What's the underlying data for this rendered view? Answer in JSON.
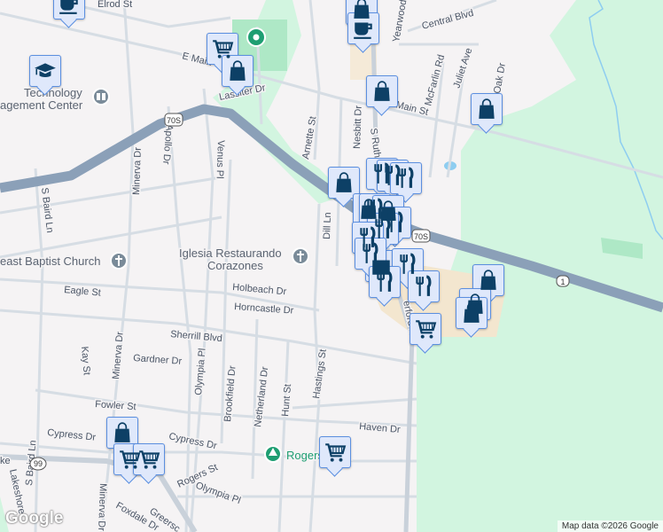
{
  "streets": {
    "elrod": "Elrod St",
    "e_main": "E Main St",
    "main": "Main St",
    "lassiter": "Lassiter Dr",
    "central": "Central Blvd",
    "yearwood": "Yearwood",
    "mcfarlin": "McFarlin Rd",
    "juliet": "Juliet Ave",
    "oak": "Oak Dr",
    "nesbitt": "Nesbitt Dr",
    "s_ruth": "S Ruth",
    "arnette": "Arnette St",
    "venus": "Venus Pl",
    "apollo": "Apollo Dr",
    "minerva": "Minerva Dr",
    "s_baird": "S Baird Ln",
    "dill": "Dill Ln",
    "holbeach": "Holbeach Dr",
    "horncastle": "Horncastle Dr",
    "eagle": "Eagle St",
    "sherrill": "Sherrill Blvd",
    "gardner": "Gardner Dr",
    "kay": "Kay St",
    "olympia": "Olympia Pl",
    "brookfield": "Brookfield Dr",
    "netherland": "Netherland Dr",
    "hunt": "Hunt St",
    "hastings": "Hastings St",
    "fowler": "Fowler St",
    "cypress": "Cypress Dr",
    "haven": "Haven Dr",
    "rogers": "Rogers St",
    "foxdale": "Foxdale Dr",
    "greers": "Greersc",
    "lakeshore": "Lakeshore",
    "lake": "ke",
    "rutherford": "erford Bl",
    "minerva2": "Minerva Dr",
    "s_baird2": "S Baird Ln"
  },
  "shields": {
    "us70s_a": "70S",
    "us70s_b": "70S",
    "i1": "1",
    "sr99": "99"
  },
  "pois": {
    "technology": "Technology",
    "mgmt": "agement Center",
    "baptist": "east Baptist Church",
    "iglesia1": "Iglesia Restaurando",
    "iglesia2": "Corazones",
    "rogers_park": "Rogers Park"
  },
  "markers": [
    {
      "icon": "coffee"
    },
    {
      "icon": "graduation-cap"
    },
    {
      "icon": "cart"
    },
    {
      "icon": "bag"
    },
    {
      "icon": "bag"
    },
    {
      "icon": "coffee"
    },
    {
      "icon": "bag"
    },
    {
      "icon": "bag"
    },
    {
      "icon": "bag"
    },
    {
      "icon": "restaurant"
    },
    {
      "icon": "restaurant"
    },
    {
      "icon": "restaurant"
    },
    {
      "icon": "bag"
    },
    {
      "icon": "restaurant"
    },
    {
      "icon": "bag"
    },
    {
      "icon": "restaurant"
    },
    {
      "icon": "restaurant"
    },
    {
      "icon": "restaurant"
    },
    {
      "icon": "store"
    },
    {
      "icon": "restaurant"
    },
    {
      "icon": "restaurant"
    },
    {
      "icon": "restaurant"
    },
    {
      "icon": "restaurant"
    },
    {
      "icon": "cart"
    },
    {
      "icon": "bag"
    },
    {
      "icon": "bag"
    },
    {
      "icon": "bag"
    },
    {
      "icon": "bag"
    },
    {
      "icon": "cart"
    },
    {
      "icon": "cart"
    },
    {
      "icon": "cart"
    }
  ],
  "branding": {
    "logo": "Google",
    "attribution": "Map data ©2026 Google"
  },
  "colors": {
    "highway": "#8ba0b8",
    "marker_fill": "#dfe8fb",
    "marker_icon": "#0d4066",
    "green": "#d2f5e0",
    "park": "#1e9e72"
  }
}
